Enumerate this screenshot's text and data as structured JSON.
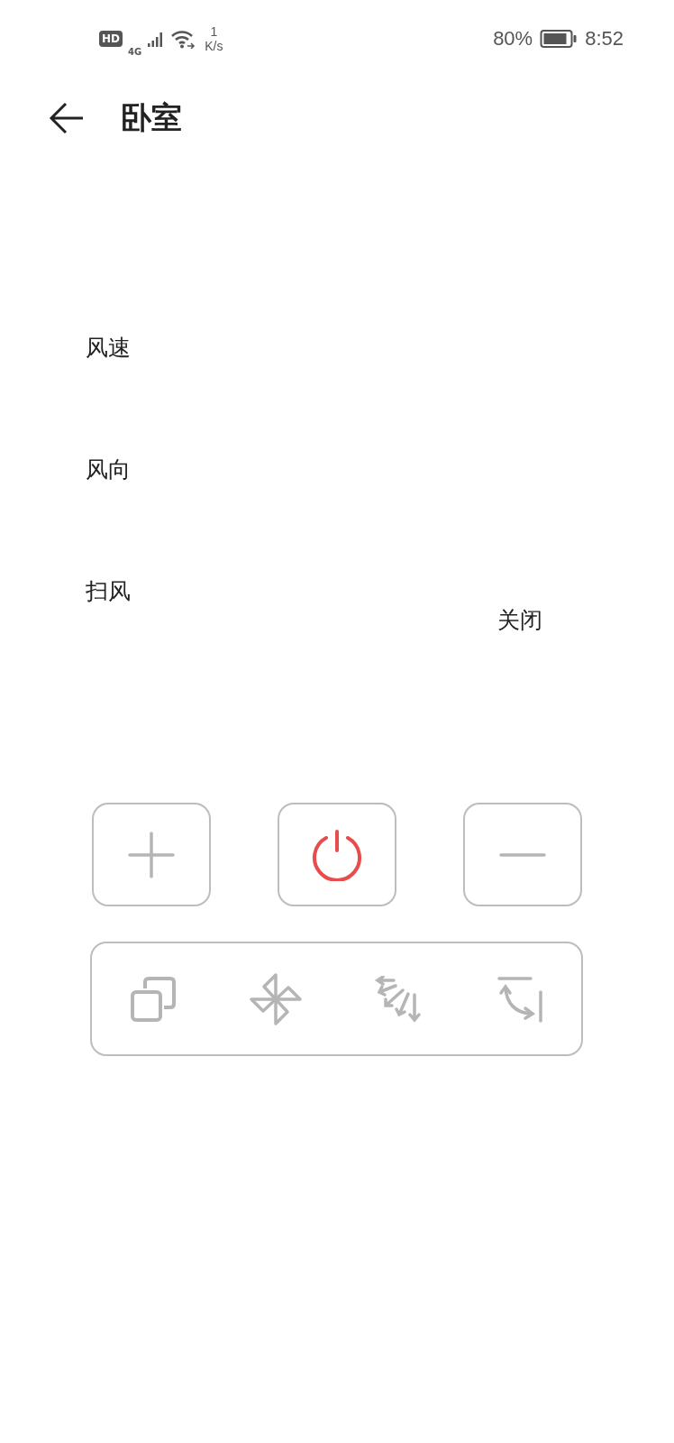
{
  "status_bar": {
    "network_badge": "HD",
    "network_type": "4G",
    "speed_value": "1",
    "speed_unit": "K/s",
    "battery": "80%",
    "time": "8:52"
  },
  "header": {
    "title": "卧室"
  },
  "settings": [
    {
      "label": "风速"
    },
    {
      "label": "风向"
    },
    {
      "label": "扫风",
      "value": "关闭"
    }
  ],
  "buttons": [
    {
      "kind": "plus"
    },
    {
      "kind": "power"
    },
    {
      "kind": "minus"
    }
  ],
  "modes": [
    {
      "kind": "copy"
    },
    {
      "kind": "fan"
    },
    {
      "kind": "swing"
    },
    {
      "kind": "rotate"
    }
  ]
}
